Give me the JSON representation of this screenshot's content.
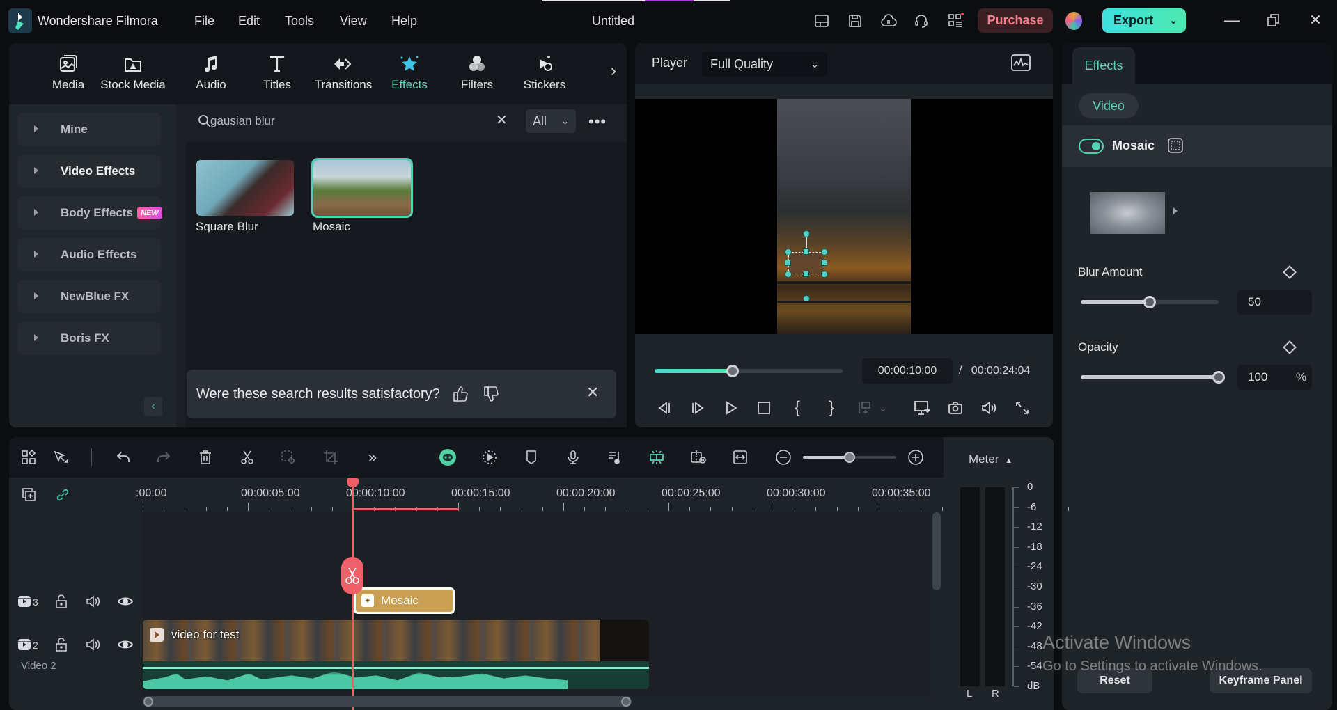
{
  "titlebar": {
    "app_name": "Wondershare Filmora",
    "menus": [
      "File",
      "Edit",
      "Tools",
      "View",
      "Help"
    ],
    "document_title": "Untitled",
    "icons": [
      "layout-icon",
      "save-icon",
      "cloud-icon",
      "support-icon",
      "apps-icon"
    ],
    "purchase_label": "Purchase",
    "export_label": "Export"
  },
  "library": {
    "tabs": [
      {
        "label": "Media",
        "icon": "media-icon"
      },
      {
        "label": "Stock Media",
        "icon": "stock-media-icon"
      },
      {
        "label": "Audio",
        "icon": "audio-icon"
      },
      {
        "label": "Titles",
        "icon": "titles-icon"
      },
      {
        "label": "Transitions",
        "icon": "transitions-icon"
      },
      {
        "label": "Effects",
        "icon": "effects-icon",
        "active": true
      },
      {
        "label": "Filters",
        "icon": "filters-icon"
      },
      {
        "label": "Stickers",
        "icon": "stickers-icon"
      }
    ],
    "sidebar": [
      {
        "label": "Mine"
      },
      {
        "label": "Video Effects",
        "active": true
      },
      {
        "label": "Body Effects",
        "badge": "NEW"
      },
      {
        "label": "Audio Effects"
      },
      {
        "label": "NewBlue FX"
      },
      {
        "label": "Boris FX"
      }
    ],
    "search": {
      "value": "gausian blur",
      "filter": "All"
    },
    "results": [
      {
        "label": "Square Blur",
        "selected": false
      },
      {
        "label": "Mosaic",
        "selected": true
      }
    ],
    "feedback": {
      "question": "Were these search results satisfactory?"
    }
  },
  "player": {
    "label": "Player",
    "quality": "Full Quality",
    "progress_fraction": 0.415,
    "current_time": "00:00:10:00",
    "separator": "/",
    "total_time": "00:00:24:04"
  },
  "properties": {
    "tab": "Effects",
    "subtab": "Video",
    "effect_name": "Mosaic",
    "effect_enabled": true,
    "blur_amount": {
      "label": "Blur Amount",
      "value": "50",
      "fraction": 0.5
    },
    "opacity": {
      "label": "Opacity",
      "value": "100",
      "unit": "%",
      "fraction": 1.0
    },
    "reset_label": "Reset",
    "keyframe_label": "Keyframe Panel"
  },
  "timeline": {
    "ruler_labels": [
      ":00:00",
      "00:00:05:00",
      "00:00:10:00",
      "00:00:15:00",
      "00:00:20:00",
      "00:00:25:00",
      "00:00:30:00",
      "00:00:35:00"
    ],
    "playhead_time": "00:00:10:00",
    "zoom_fraction": 0.5,
    "tracks": [
      {
        "number": "3",
        "name": ""
      },
      {
        "number": "2",
        "name": "Video 2"
      }
    ],
    "effect_clip": {
      "label": "Mosaic"
    },
    "video_clip": {
      "label": "video for test"
    }
  },
  "meter": {
    "label": "Meter",
    "scale": [
      "0",
      "-6",
      "-12",
      "-18",
      "-24",
      "-30",
      "-36",
      "-42",
      "-48",
      "-54",
      "dB"
    ],
    "channels": [
      "L",
      "R"
    ]
  },
  "watermark": {
    "line1": "Activate Windows",
    "line2": "Go to Settings to activate Windows."
  }
}
